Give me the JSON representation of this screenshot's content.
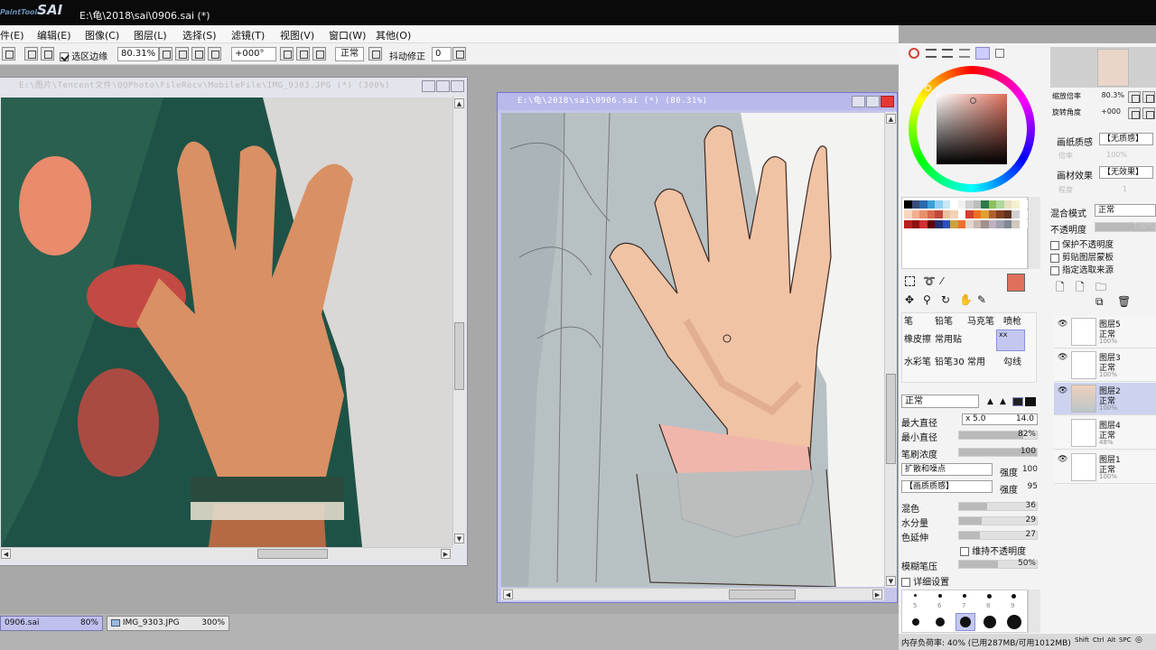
{
  "app": {
    "logo_main": "SAI",
    "logo_small": "PaintTool",
    "window_title": "E:\\龟\\2018\\sai\\0906.sai (*)"
  },
  "menu": [
    "件(E)",
    "编辑(E)",
    "图像(C)",
    "图层(L)",
    "选择(S)",
    "滤镜(T)",
    "视图(V)",
    "窗口(W)",
    "其他(O)"
  ],
  "toolbar": {
    "selection_edge_label": "选区边缘",
    "zoom": "80.31%",
    "rotation": "+000°",
    "blend_mode": "正常",
    "stabilizer_label": "抖动修正",
    "stabilizer_value": "0"
  },
  "ref_window": {
    "title": "E:\\图片\\Tencent文件\\QQPhoto\\FileRecv\\MobileFile\\IMG_9303.JPG (*) (300%)"
  },
  "main_window": {
    "title": "E:\\龟\\2018\\sai\\0906.sai (*) (80.31%)"
  },
  "tasks": [
    {
      "name": "0906.sai",
      "zoom": "80%"
    },
    {
      "name": "IMG_9303.JPG",
      "zoom": "300%"
    }
  ],
  "navigator": {
    "zoom_label": "缩放倍率",
    "zoom_value": "80.3%",
    "rotate_label": "旋转角度",
    "rotate_value": "+000"
  },
  "layer_props": {
    "paper_texture_label": "画纸质感",
    "paper_texture_value": "【无质感】",
    "texture_sub_a": "倍率",
    "texture_sub_a_val": "100%",
    "material_effect_label": "画材效果",
    "material_effect_value": "【无效果】",
    "texture_sub_b": "程度",
    "texture_sub_b_val": "1",
    "blend_label": "混合模式",
    "blend_value": "正常",
    "opacity_label": "不透明度",
    "opacity_value": "100%",
    "protect_opacity": "保护不透明度",
    "clipping_group": "剪贴图层蒙板",
    "selection_source": "指定选取来源"
  },
  "brushes": {
    "row1": [
      "笔",
      "铅笔",
      "马克笔",
      "喷枪"
    ],
    "row2": [
      "橡皮擦",
      "常用贴",
      "",
      "xx"
    ],
    "row3": [
      "水彩笔",
      "铅笔30",
      "常用",
      "勾线"
    ]
  },
  "brush_settings": {
    "mode": "正常",
    "max_size_label": "最大直径",
    "max_size_mult": "x 5.0",
    "max_size_value": "14.0",
    "min_size_label": "最小直径",
    "min_size_value": "82%",
    "density_label": "笔刷浓度",
    "density_value": "100",
    "shape_label": "扩散和噪点",
    "shape_strength_label": "强度",
    "shape_strength_value": "100",
    "texture_label": "【画质质感】",
    "texture_strength_label": "强度",
    "texture_strength_value": "95",
    "blending_label": "混色",
    "blending_value": "36",
    "dilution_label": "水分量",
    "dilution_value": "29",
    "persistence_label": "色延伸",
    "persistence_value": "27",
    "keep_opacity_label": "维持不透明度",
    "blur_pressure_label": "模糊笔压",
    "blur_pressure_value": "50%",
    "advanced_label": "详细设置"
  },
  "size_presets": [
    "5",
    "6",
    "7",
    "8",
    "9"
  ],
  "layers": [
    {
      "name": "图层5",
      "mode": "正常",
      "opacity": "100%",
      "selected": false
    },
    {
      "name": "图层3",
      "mode": "正常",
      "opacity": "100%",
      "selected": false
    },
    {
      "name": "图层2",
      "mode": "正常",
      "opacity": "100%",
      "selected": true
    },
    {
      "name": "图层4",
      "mode": "正常",
      "opacity": "48%",
      "selected": false
    },
    {
      "name": "图层1",
      "mode": "正常",
      "opacity": "100%",
      "selected": false
    }
  ],
  "status": {
    "memory": "内存负荷率: 40% (已用287MB/可用1012MB)",
    "keys": [
      "Shift",
      "Ctrl",
      "Alt",
      "SPC",
      "◎"
    ]
  },
  "colors": {
    "current_color": "#e0705c",
    "selection_highlight": "#cdd2ee",
    "close_button": "#e33838"
  },
  "palette": [
    "#000000",
    "#3a4b7a",
    "#2a6ab0",
    "#3ea0d8",
    "#8fd0f0",
    "#c9e6f5",
    "#ffffff",
    "#f0f0f0",
    "#d0d0d0",
    "#bdbdbd",
    "#2e7a4a",
    "#8dc060",
    "#b0d8a0",
    "#e8e0c0",
    "#f5f0d0",
    "#ffffff",
    "#f8d5c0",
    "#f0b090",
    "#e8906a",
    "#d86a4a",
    "#c04a3a",
    "#e8c0a0",
    "#f2d2b8",
    "#ffffff",
    "#d04030",
    "#f07020",
    "#e0a030",
    "#b06030",
    "#804020",
    "#603020",
    "#d0d0d0",
    "#ffffff",
    "#b82020",
    "#901010",
    "#d03030",
    "#600000",
    "#203070",
    "#3050b0",
    "#d0a040",
    "#f07030",
    "#e0d8d0",
    "#c8b8b0",
    "#a09090",
    "#c0b0c0",
    "#a0a0b0",
    "#808898",
    "#d0c8c0",
    "#ffffff"
  ]
}
